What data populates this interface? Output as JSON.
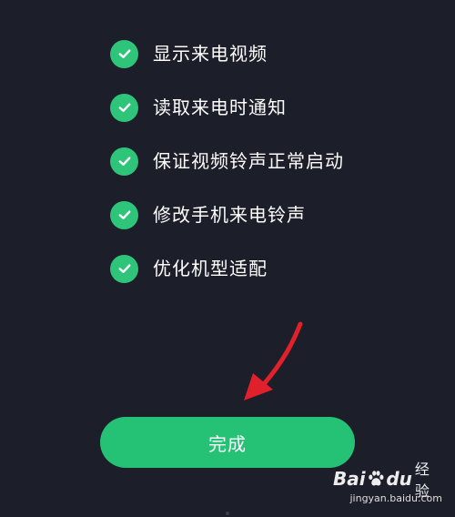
{
  "permissions": [
    {
      "label": "显示来电视频",
      "icon": "check-circle-icon"
    },
    {
      "label": "读取来电时通知",
      "icon": "check-circle-icon"
    },
    {
      "label": "保证视频铃声正常启动",
      "icon": "check-circle-icon"
    },
    {
      "label": "修改手机来电铃声",
      "icon": "check-circle-icon"
    },
    {
      "label": "优化机型适配",
      "icon": "check-circle-icon"
    }
  ],
  "done_button": {
    "label": "完成"
  },
  "watermark": {
    "brand_left": "Bai",
    "brand_right": "du",
    "brand_suffix": "经验",
    "url": "jingyan.baidu.com"
  },
  "colors": {
    "background": "#1c1e29",
    "accent": "#25c276",
    "check": "#2ec57a",
    "arrow": "#e0202a"
  }
}
